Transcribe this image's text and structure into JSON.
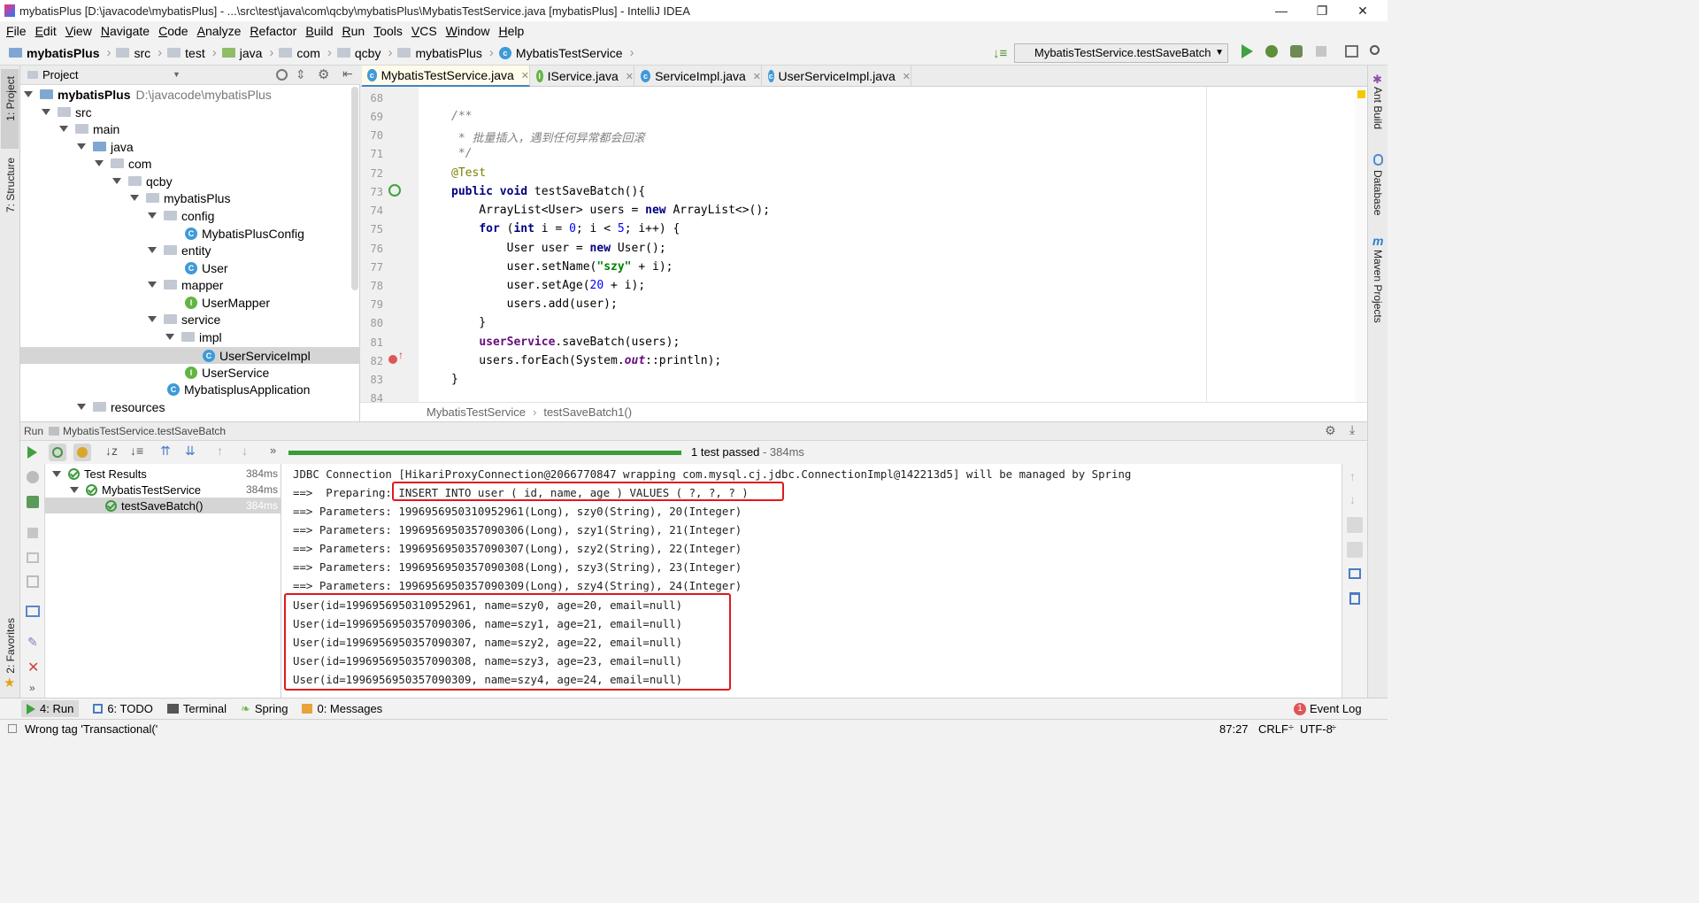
{
  "window": {
    "title": "mybatisPlus [D:\\javacode\\mybatisPlus] - ...\\src\\test\\java\\com\\qcby\\mybatisPlus\\MybatisTestService.java [mybatisPlus] - IntelliJ IDEA",
    "minimize": "—",
    "maximize": "❐",
    "close": "✕"
  },
  "menu": [
    "File",
    "Edit",
    "View",
    "Navigate",
    "Code",
    "Analyze",
    "Refactor",
    "Build",
    "Run",
    "Tools",
    "VCS",
    "Window",
    "Help"
  ],
  "breadcrumb": [
    "mybatisPlus",
    "src",
    "test",
    "java",
    "com",
    "qcby",
    "mybatisPlus",
    "MybatisTestService"
  ],
  "run_config": "MybatisTestService.testSaveBatch",
  "side_left": {
    "project": "1: Project",
    "structure": "7: Structure",
    "favorites": "2: Favorites"
  },
  "side_right": {
    "ant": "Ant Build",
    "database": "Database",
    "maven": "Maven Projects"
  },
  "project_panel": {
    "title": "Project",
    "tree": [
      {
        "label": "mybatisPlus",
        "extra": "D:\\javacode\\mybatisPlus"
      },
      {
        "label": "src"
      },
      {
        "label": "main"
      },
      {
        "label": "java"
      },
      {
        "label": "com"
      },
      {
        "label": "qcby"
      },
      {
        "label": "mybatisPlus"
      },
      {
        "label": "config"
      },
      {
        "label": "MybatisPlusConfig"
      },
      {
        "label": "entity"
      },
      {
        "label": "User"
      },
      {
        "label": "mapper"
      },
      {
        "label": "UserMapper"
      },
      {
        "label": "service"
      },
      {
        "label": "impl"
      },
      {
        "label": "UserServiceImpl"
      },
      {
        "label": "UserService"
      },
      {
        "label": "MybatisplusApplication"
      },
      {
        "label": "resources"
      }
    ]
  },
  "tabs": [
    "MybatisTestService.java",
    "IService.java",
    "ServiceImpl.java",
    "UserServiceImpl.java"
  ],
  "editor": {
    "line_numbers": [
      "68",
      "69",
      "70",
      "71",
      "72",
      "73",
      "74",
      "75",
      "76",
      "77",
      "78",
      "79",
      "80",
      "81",
      "82",
      "83",
      "84"
    ],
    "breadcrumb": [
      "MybatisTestService",
      "testSaveBatch1()"
    ]
  },
  "run_panel": {
    "header_label": "Run",
    "header_config": "MybatisTestService.testSaveBatch",
    "status": "1 test passed",
    "duration": " - 384ms",
    "tests": [
      {
        "label": "Test Results",
        "time": "384ms"
      },
      {
        "label": "MybatisTestService",
        "time": "384ms"
      },
      {
        "label": "testSaveBatch()",
        "time": "384ms"
      }
    ],
    "console": [
      "JDBC Connection [HikariProxyConnection@2066770847 wrapping com.mysql.cj.jdbc.ConnectionImpl@142213d5] will be managed by Spring",
      "==>  Preparing: INSERT INTO user ( id, name, age ) VALUES ( ?, ?, ? )",
      "==> Parameters: 1996956950310952961(Long), szy0(String), 20(Integer)",
      "==> Parameters: 1996956950357090306(Long), szy1(String), 21(Integer)",
      "==> Parameters: 1996956950357090307(Long), szy2(String), 22(Integer)",
      "==> Parameters: 1996956950357090308(Long), szy3(String), 23(Integer)",
      "==> Parameters: 1996956950357090309(Long), szy4(String), 24(Integer)",
      "User(id=1996956950310952961, name=szy0, age=20, email=null)",
      "User(id=1996956950357090306, name=szy1, age=21, email=null)",
      "User(id=1996956950357090307, name=szy2, age=22, email=null)",
      "User(id=1996956950357090308, name=szy3, age=23, email=null)",
      "User(id=1996956950357090309, name=szy4, age=24, email=null)"
    ]
  },
  "bottom_tabs": [
    "4: Run",
    "6: TODO",
    "Terminal",
    "Spring",
    "0: Messages"
  ],
  "event_log": "Event Log",
  "event_count": "1",
  "status": {
    "message": "Wrong tag 'Transactional('",
    "position": "87:27",
    "line_sep": "CRLF",
    "encoding": "UTF-8"
  },
  "colors": {
    "pass_green": "#3b9b3b",
    "highlight_red": "#e0191b",
    "tab_active": "#fffceb",
    "selection": "#d5d5d5"
  }
}
